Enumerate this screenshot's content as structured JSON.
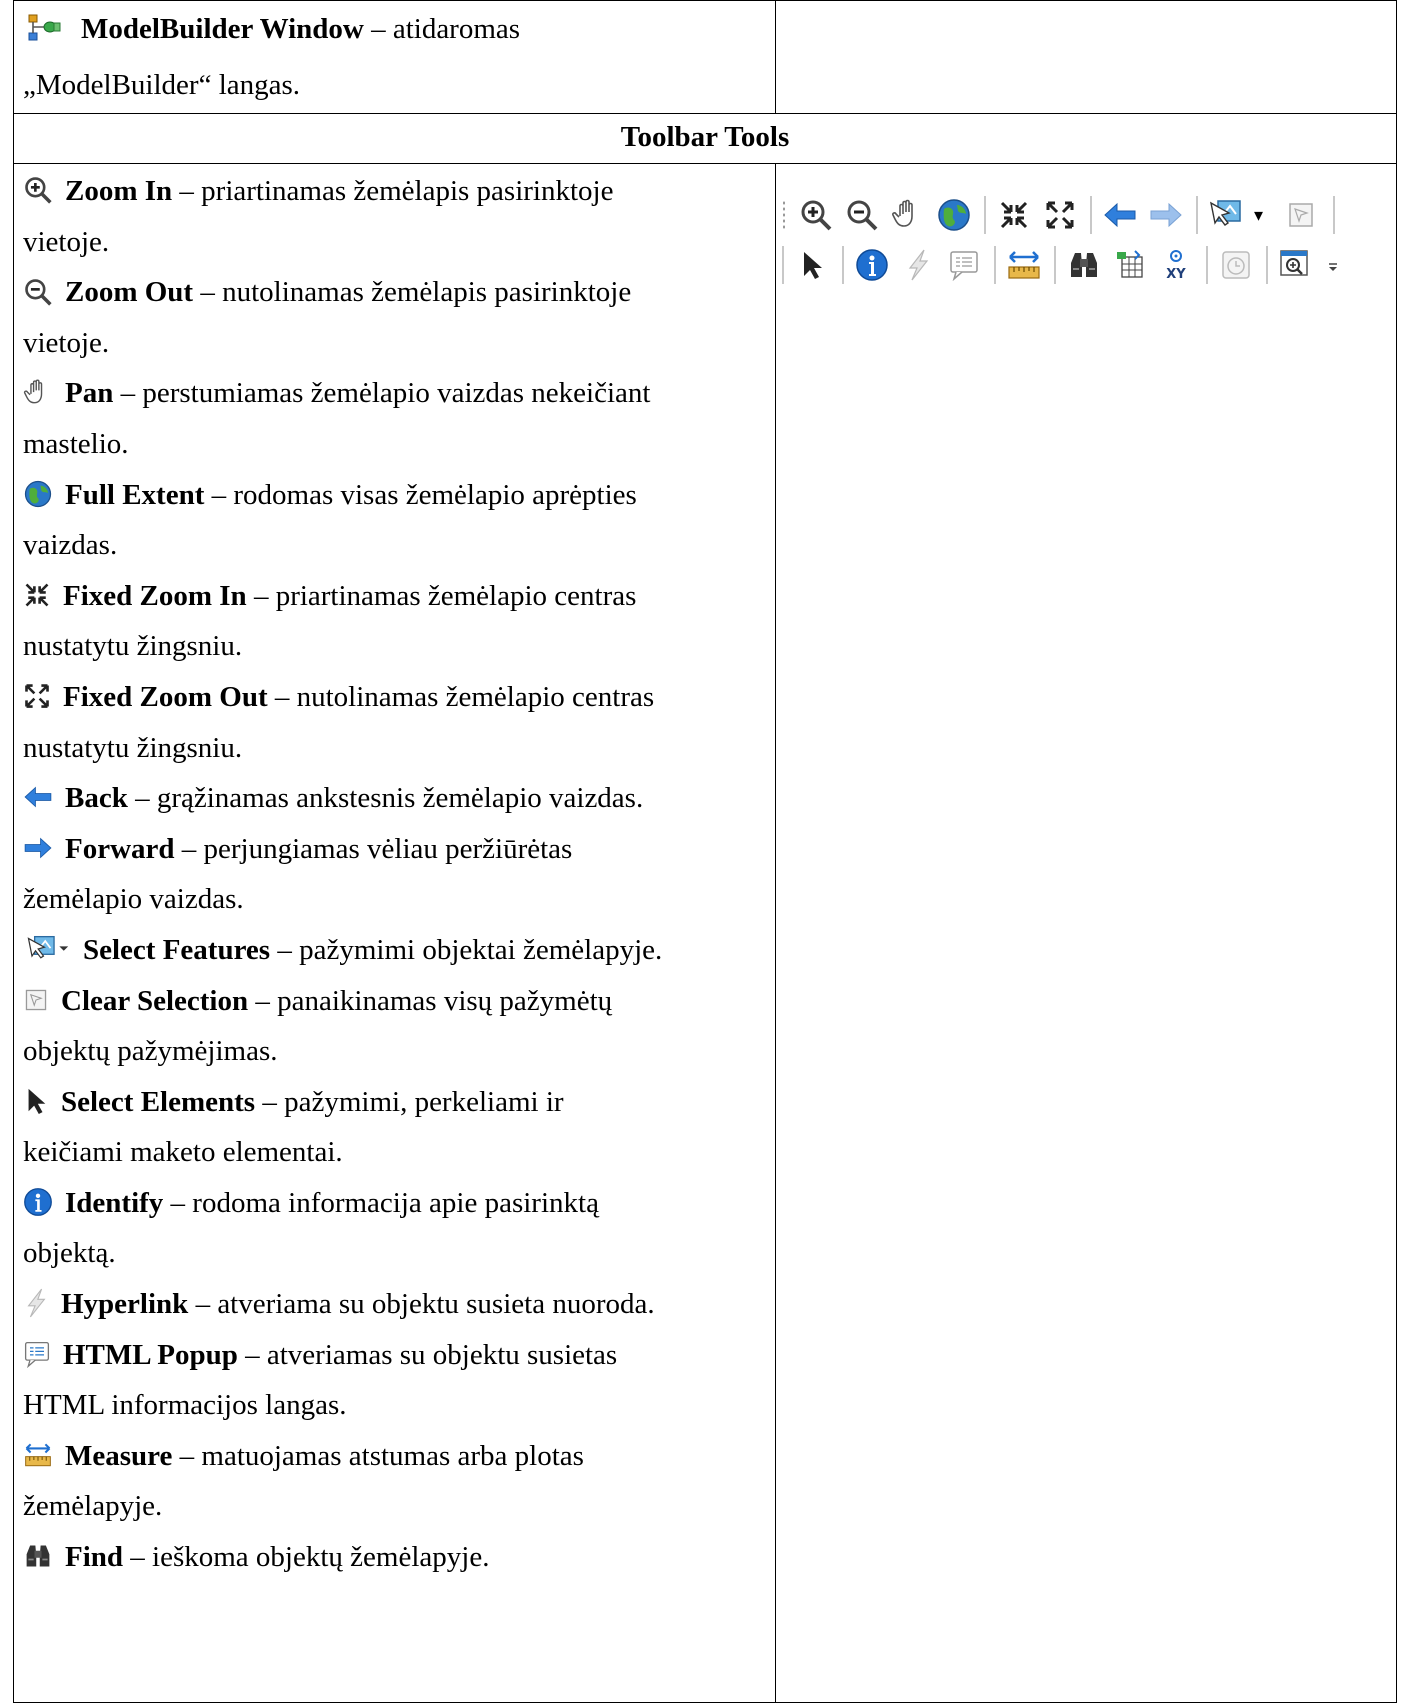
{
  "modelbuilder": {
    "title": "ModelBuilder Window",
    "desc_line1": " – atidaromas",
    "desc_line2": "„ModelBuilder“ langas."
  },
  "section_header": "Toolbar Tools",
  "tools": [
    {
      "icon": "zoom-in-icon",
      "name": "Zoom In",
      "desc1": " – priartinamas žemėlapis pasirinktoje",
      "desc2": "vietoje."
    },
    {
      "icon": "zoom-out-icon",
      "name": "Zoom Out",
      "desc1": " – nutolinamas žemėlapis pasirinktoje",
      "desc2": "vietoje."
    },
    {
      "icon": "pan-hand-icon",
      "name": "Pan",
      "desc1": " – perstumiamas žemėlapio vaizdas nekeičiant",
      "desc2": "mastelio."
    },
    {
      "icon": "globe-icon",
      "name": "Full Extent",
      "desc1": " – rodomas visas žemėlapio aprėpties",
      "desc2": "vaizdas."
    },
    {
      "icon": "fixed-zoom-in-icon",
      "name": "Fixed Zoom In",
      "desc1": " – priartinamas žemėlapio centras",
      "desc2": "nustatytu žingsniu."
    },
    {
      "icon": "fixed-zoom-out-icon",
      "name": "Fixed Zoom Out",
      "desc1": " – nutolinamas žemėlapio centras",
      "desc2": "nustatytu žingsniu."
    },
    {
      "icon": "back-arrow-icon",
      "name": "Back",
      "desc1": " – grąžinamas ankstesnis žemėlapio vaizdas.",
      "desc2": ""
    },
    {
      "icon": "forward-arrow-icon",
      "name": "Forward",
      "desc1": " – perjungiamas vėliau peržiūrėtas",
      "desc2": "žemėlapio vaizdas."
    },
    {
      "icon": "select-features-icon",
      "name": "Select Features",
      "desc1": " – pažymimi objektai žemėlapyje.",
      "desc2": ""
    },
    {
      "icon": "clear-selection-icon",
      "name": "Clear Selection",
      "desc1": " – panaikinamas visų pažymėtų",
      "desc2": "objektų pažymėjimas."
    },
    {
      "icon": "select-elements-arrow-icon",
      "name": "Select Elements",
      "desc1": " – pažymimi, perkeliami ir",
      "desc2": "keičiami maketo elementai."
    },
    {
      "icon": "identify-info-icon",
      "name": "Identify",
      "desc1": " – rodoma informacija apie pasirinktą",
      "desc2": "objektą."
    },
    {
      "icon": "hyperlink-bolt-icon",
      "name": "Hyperlink",
      "desc1": " – atveriama su objektu susieta nuoroda.",
      "desc2": ""
    },
    {
      "icon": "html-popup-icon",
      "name": "HTML Popup",
      "desc1": " – atveriamas su objektu susietas",
      "desc2": "HTML informacijos langas."
    },
    {
      "icon": "measure-ruler-icon",
      "name": "Measure",
      "desc1": " – matuojamas atstumas arba plotas",
      "desc2": "žemėlapyje."
    },
    {
      "icon": "find-binoculars-icon",
      "name": "Find",
      "desc1": " – ieškoma objektų žemėlapyje.",
      "desc2": ""
    }
  ],
  "colors": {
    "border": "#000000",
    "accent_blue": "#1f6fd0",
    "arrow_blue": "#2f7fdc"
  }
}
